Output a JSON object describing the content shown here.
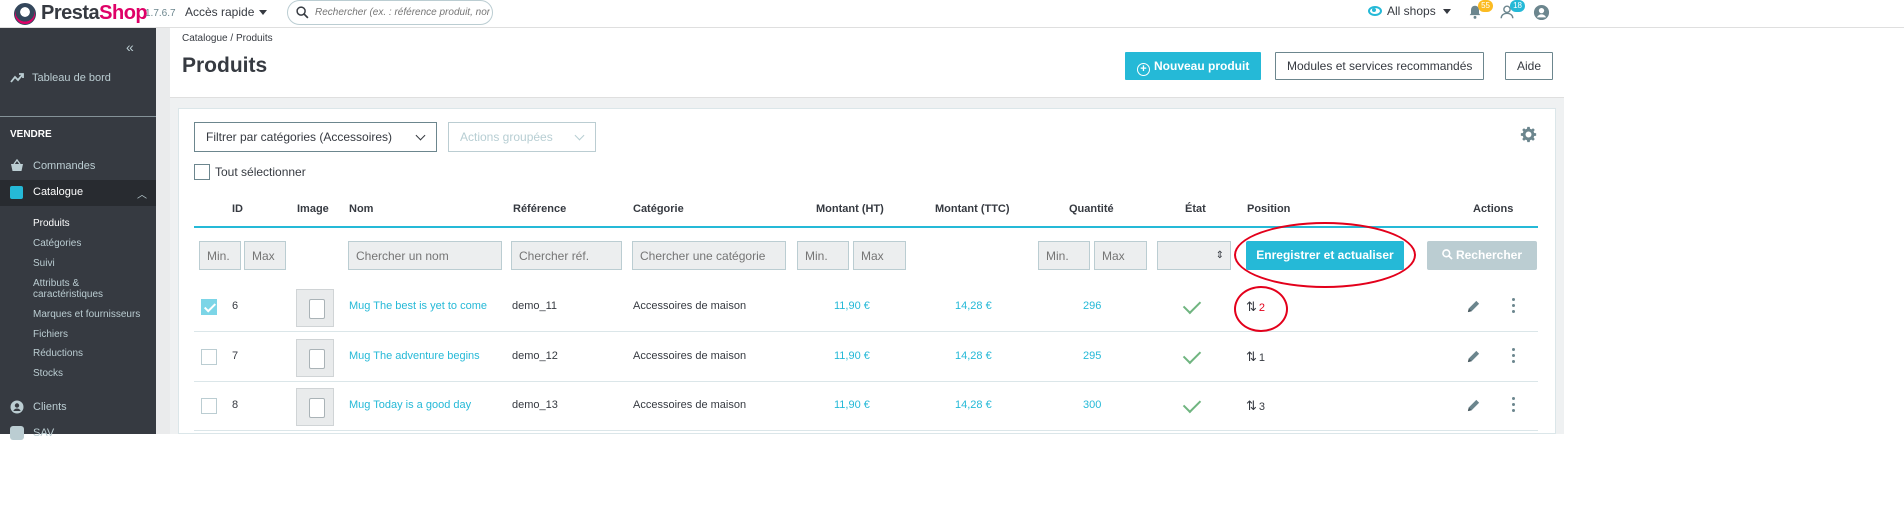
{
  "topbar": {
    "brand_a": "Presta",
    "brand_b": "Shop",
    "version": "1.7.6.7",
    "quick_access": "Accès rapide",
    "search_placeholder": "Rechercher (ex. : référence produit, nom",
    "shops": "All shops",
    "notif_orders": "55",
    "notif_customers": "18"
  },
  "sidebar": {
    "dashboard": "Tableau de bord",
    "section": "VENDRE",
    "orders": "Commandes",
    "catalog": "Catalogue",
    "catalog_sub": [
      "Produits",
      "Catégories",
      "Suivi",
      "Attributs & caractéristiques",
      "Marques et fournisseurs",
      "Fichiers",
      "Réductions",
      "Stocks"
    ],
    "customers": "Clients",
    "sav": "SAV"
  },
  "header": {
    "breadcrumb_1": "Catalogue",
    "breadcrumb_sep": "/",
    "breadcrumb_2": "Produits",
    "title": "Produits",
    "new_product": "Nouveau produit",
    "modules": "Modules et services recommandés",
    "help": "Aide"
  },
  "toolbar": {
    "filter_categories": "Filtrer par catégories (Accessoires)",
    "bulk_actions": "Actions groupées",
    "select_all": "Tout sélectionner"
  },
  "table": {
    "headers": [
      "ID",
      "Image",
      "Nom",
      "Référence",
      "Catégorie",
      "Montant (HT)",
      "Montant (TTC)",
      "Quantité",
      "État",
      "Position",
      "Actions"
    ],
    "filters": {
      "min": "Min.",
      "max": "Max",
      "name": "Chercher un nom",
      "ref": "Chercher réf.",
      "category": "Chercher une catégorie"
    },
    "save_refresh": "Enregistrer et actualiser",
    "search": "Rechercher",
    "rows": [
      {
        "id": "6",
        "name": "Mug The best is yet to come",
        "ref": "demo_11",
        "category": "Accessoires de maison",
        "price_ht": "11,90 €",
        "price_ttc": "14,28 €",
        "qty": "296",
        "position": "2",
        "checked": true
      },
      {
        "id": "7",
        "name": "Mug The adventure begins",
        "ref": "demo_12",
        "category": "Accessoires de maison",
        "price_ht": "11,90 €",
        "price_ttc": "14,28 €",
        "qty": "295",
        "position": "1",
        "checked": false
      },
      {
        "id": "8",
        "name": "Mug Today is a good day",
        "ref": "demo_13",
        "category": "Accessoires de maison",
        "price_ht": "11,90 €",
        "price_ttc": "14,28 €",
        "qty": "300",
        "position": "3",
        "checked": false
      }
    ]
  },
  "colors": {
    "accent": "#25b9d7",
    "brand_pink": "#df0067",
    "annotation_red": "#e3001b",
    "sidebar": "#363a41"
  },
  "icons": [
    "logo-icon",
    "search-icon",
    "eye-icon",
    "bell-icon",
    "customers-icon",
    "user-icon",
    "trend-icon",
    "cart-icon",
    "store-icon",
    "person-icon",
    "gear-icon",
    "pencil-icon",
    "kebab-icon",
    "sort-arrows-icon",
    "check-icon"
  ]
}
